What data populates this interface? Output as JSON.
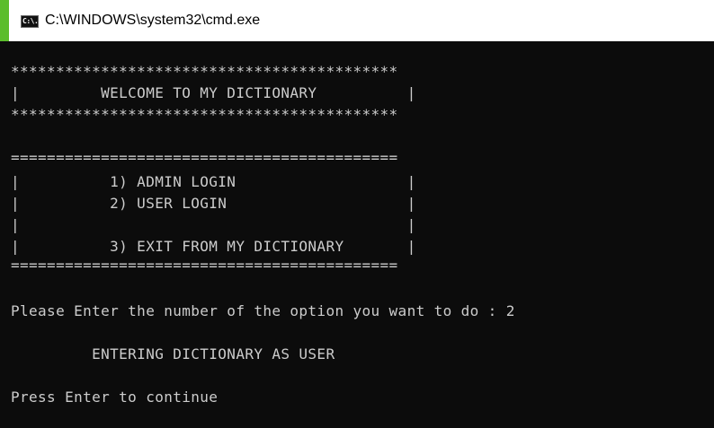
{
  "window": {
    "title": "C:\\WINDOWS\\system32\\cmd.exe",
    "icon_text": "C:\\."
  },
  "console": {
    "lines": [
      "",
      "*******************************************",
      "|         WELCOME TO MY DICTIONARY          |",
      "*******************************************",
      "",
      "===========================================",
      "|          1) ADMIN LOGIN                   |",
      "|          2) USER LOGIN                    |",
      "|                                           |",
      "|          3) EXIT FROM MY DICTIONARY       |",
      "===========================================",
      "",
      "Please Enter the number of the option you want to do : 2",
      "",
      "         ENTERING DICTIONARY AS USER",
      "",
      "Press Enter to continue"
    ]
  },
  "colors": {
    "console_bg": "#0c0c0c",
    "console_text": "#cccccc",
    "accent": "#5bbd2b",
    "title_bar_bg": "#ffffff"
  }
}
